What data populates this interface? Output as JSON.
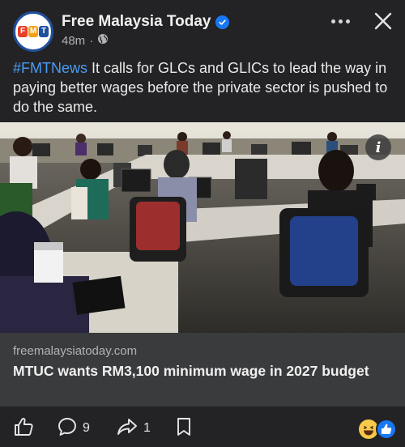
{
  "post": {
    "page_name": "Free Malaysia Today",
    "logo_letters": [
      "F",
      "M",
      "T"
    ],
    "time": "48m",
    "separator": "·",
    "hashtag": "#FMTNews",
    "text": " It calls for GLCs and GLICs to lead the way in paying better wages before the private sector is pushed to do the same."
  },
  "link_card": {
    "domain": "freemalaysiatoday.com",
    "title": "MTUC wants RM3,100 minimum wage in 2027 budget"
  },
  "actions": {
    "comment_count": "9",
    "share_count": "1"
  },
  "icons": {
    "verified": "verified-badge-icon",
    "audience": "globe-icon",
    "more": "more-dots-icon",
    "close": "close-icon",
    "info": "info-icon",
    "like": "thumbs-up-icon",
    "comment": "comment-bubble-icon",
    "share": "share-arrow-icon",
    "save": "bookmark-icon",
    "reactions": [
      "haha-reaction-icon",
      "like-reaction-icon"
    ]
  },
  "colors": {
    "background": "#232325",
    "hashtag": "#4b9cf5",
    "verified": "#1877f2",
    "card": "#3a3b3d"
  }
}
